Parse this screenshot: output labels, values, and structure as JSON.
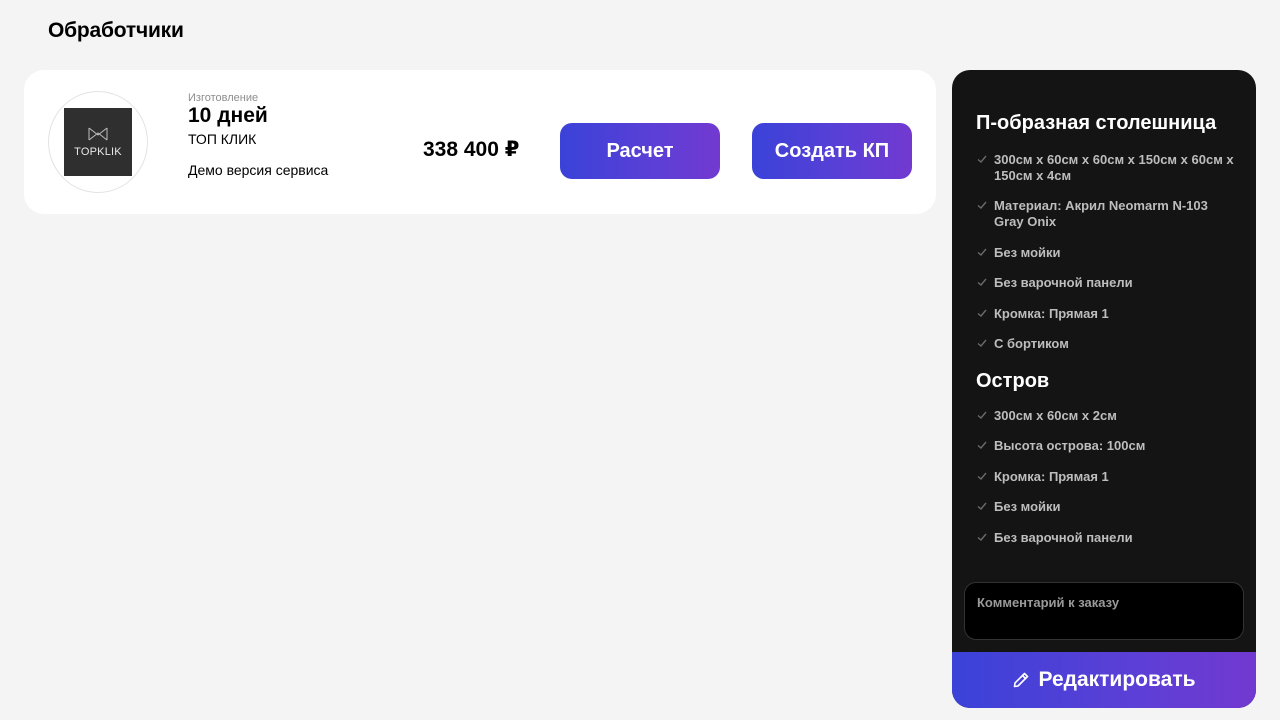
{
  "page": {
    "title": "Обработчики"
  },
  "vendor": {
    "logo_text": "TOPKLIK",
    "caption": "Изготовление",
    "days": "10 дней",
    "company": "ТОП КЛИК",
    "note": "Демо версия сервиса",
    "price": "338 400 ₽",
    "calc_label": "Расчет",
    "kp_label": "Создать КП"
  },
  "panel": {
    "sections": [
      {
        "title": "П-образная столешница",
        "items": [
          "300см х 60см х 60см х 150см х 60см х 150см х 4см",
          "Материал: Акрил Neomarm N-103 Gray Onix",
          "Без мойки",
          "Без варочной панели",
          "Кромка: Прямая 1",
          "С бортиком"
        ]
      },
      {
        "title": "Остров",
        "items": [
          "300см х 60см х 2см",
          "Высота острова: 100см",
          "Кромка: Прямая 1",
          "Без мойки",
          "Без варочной панели"
        ]
      }
    ],
    "comment_placeholder": "Комментарий к заказу",
    "edit_label": "Редактировать"
  },
  "icons": {
    "check": "check-icon",
    "pencil": "pencil-icon",
    "logo": "topklik-logo"
  },
  "colors": {
    "accent_start": "#3a42d8",
    "accent_end": "#7239d0",
    "panel_bg": "#141414",
    "page_bg": "#f4f4f4"
  }
}
